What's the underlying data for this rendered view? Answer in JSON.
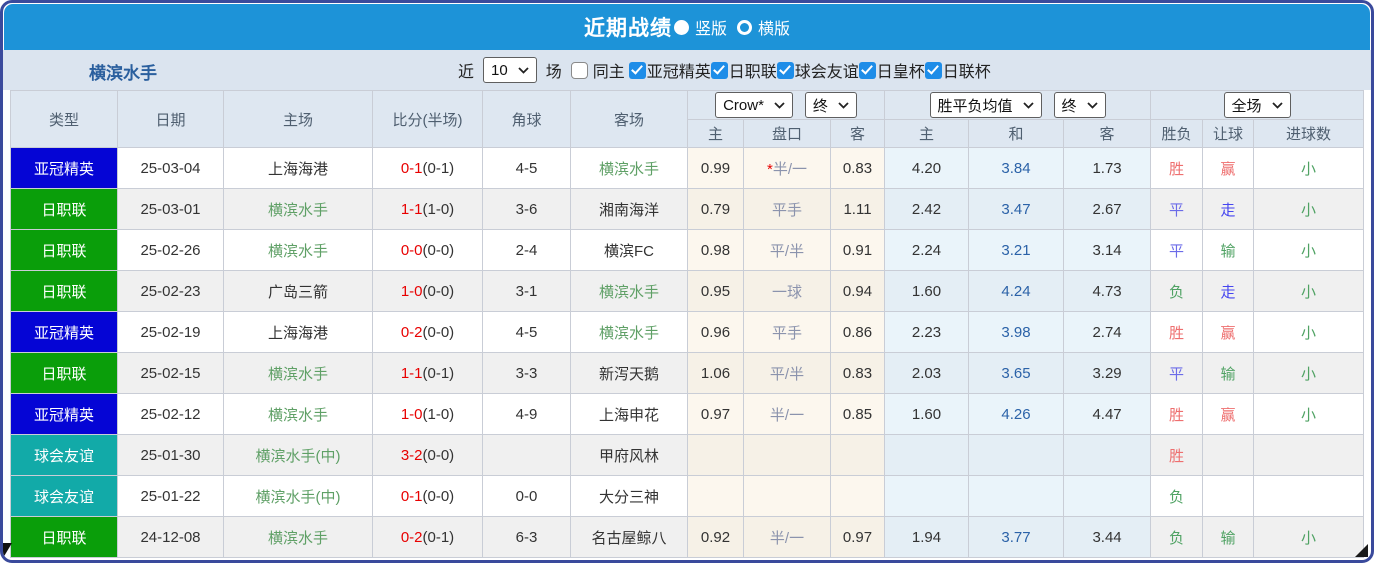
{
  "colors": {
    "topbar": "#1d93d8",
    "frame": "#3a4a9c",
    "filter_bg": "#dbe4ef",
    "header_bg": "#dee7f1",
    "header_text": "#4f5f70",
    "row_alt": "#f0f0f0",
    "odds_left_bg": "#fcf7ee",
    "odds_right_bg": "#eaf4fa",
    "cell_border": "#c9cdd6",
    "team_blue": "#2a5f9e",
    "team_green": "#5fa066",
    "score_red": "#e80000",
    "handicap_slate": "#8b93ad",
    "avg_blue": "#2b62a8",
    "checkbox_blue": "#1e8de8",
    "type_blue": "#0505d5",
    "type_green": "#0a9e0a",
    "type_teal": "#12aaa8",
    "red": "#ee6f6f",
    "blue": "#6b6be8",
    "blue2": "#4646f0",
    "green": "#4fa263",
    "indicator_green": "#0a8a0a"
  },
  "titlebar": {
    "title": "近期战绩",
    "radios": [
      {
        "label": "竖版",
        "selected": false
      },
      {
        "label": "横版",
        "selected": true
      }
    ]
  },
  "filterbar": {
    "team": "横滨水手",
    "near_label": "近",
    "matches_select": "10",
    "games_label": "场",
    "same_home": {
      "label": "同主",
      "checked": false
    },
    "leagues": [
      {
        "label": "亚冠精英",
        "checked": true
      },
      {
        "label": "日职联",
        "checked": true
      },
      {
        "label": "球会友谊",
        "checked": true
      },
      {
        "label": "日皇杯",
        "checked": true
      },
      {
        "label": "日联杯",
        "checked": true
      }
    ]
  },
  "table": {
    "main_headers": [
      "类型",
      "日期",
      "主场",
      "比分(半场)",
      "角球",
      "客场"
    ],
    "selects": {
      "odds_company": "Crow*",
      "odds_time": "终",
      "avg_label": "胜平负均值",
      "avg_time": "终",
      "full_match": "全场"
    },
    "sub_headers": [
      "主",
      "盘口",
      "客",
      "主",
      "和",
      "客",
      "胜负",
      "让球",
      "进球数"
    ],
    "rows": [
      {
        "type": "亚冠精英",
        "type_color": "blue",
        "date": "25-03-04",
        "home": "上海海港",
        "home_green": false,
        "score": "0-1",
        "half": "(0-1)",
        "corner": "4-5",
        "away": "横滨水手",
        "away_green": true,
        "crow_home": "0.99",
        "handicap": "半/一",
        "handicap_star": true,
        "crow_away": "0.83",
        "avg_win": "4.20",
        "avg_draw": "3.84",
        "avg_lose": "1.73",
        "result": "胜",
        "result_color": "red",
        "let_result": "赢",
        "let_color": "red",
        "goals": "小",
        "goals_color": "green"
      },
      {
        "type": "日职联",
        "type_color": "green",
        "date": "25-03-01",
        "home": "横滨水手",
        "home_green": true,
        "score": "1-1",
        "half": "(1-0)",
        "corner": "3-6",
        "away": "湘南海洋",
        "away_green": false,
        "crow_home": "0.79",
        "handicap": "平手",
        "handicap_star": false,
        "crow_away": "1.11",
        "avg_win": "2.42",
        "avg_draw": "3.47",
        "avg_lose": "2.67",
        "result": "平",
        "result_color": "blue",
        "let_result": "走",
        "let_color": "blue2",
        "goals": "小",
        "goals_color": "green"
      },
      {
        "type": "日职联",
        "type_color": "green",
        "date": "25-02-26",
        "home": "横滨水手",
        "home_green": true,
        "score": "0-0",
        "half": "(0-0)",
        "corner": "2-4",
        "away": "横滨FC",
        "away_green": false,
        "crow_home": "0.98",
        "handicap": "平/半",
        "handicap_star": false,
        "crow_away": "0.91",
        "avg_win": "2.24",
        "avg_draw": "3.21",
        "avg_lose": "3.14",
        "result": "平",
        "result_color": "blue",
        "let_result": "输",
        "let_color": "green",
        "goals": "小",
        "goals_color": "green"
      },
      {
        "type": "日职联",
        "type_color": "green",
        "date": "25-02-23",
        "home": "广岛三箭",
        "home_green": false,
        "score": "1-0",
        "half": "(0-0)",
        "corner": "3-1",
        "away": "横滨水手",
        "away_green": true,
        "crow_home": "0.95",
        "handicap": "一球",
        "handicap_star": false,
        "crow_away": "0.94",
        "avg_win": "1.60",
        "avg_draw": "4.24",
        "avg_lose": "4.73",
        "result": "负",
        "result_color": "green",
        "let_result": "走",
        "let_color": "blue2",
        "goals": "小",
        "goals_color": "green"
      },
      {
        "type": "亚冠精英",
        "type_color": "blue",
        "date": "25-02-19",
        "home": "上海海港",
        "home_green": false,
        "score": "0-2",
        "half": "(0-0)",
        "corner": "4-5",
        "away": "横滨水手",
        "away_green": true,
        "crow_home": "0.96",
        "handicap": "平手",
        "handicap_star": false,
        "crow_away": "0.86",
        "avg_win": "2.23",
        "avg_draw": "3.98",
        "avg_lose": "2.74",
        "result": "胜",
        "result_color": "red",
        "let_result": "赢",
        "let_color": "red",
        "goals": "小",
        "goals_color": "green"
      },
      {
        "type": "日职联",
        "type_color": "green",
        "date": "25-02-15",
        "home": "横滨水手",
        "home_green": true,
        "score": "1-1",
        "half": "(0-1)",
        "corner": "3-3",
        "away": "新泻天鹅",
        "away_green": false,
        "crow_home": "1.06",
        "handicap": "平/半",
        "handicap_star": false,
        "crow_away": "0.83",
        "avg_win": "2.03",
        "avg_draw": "3.65",
        "avg_lose": "3.29",
        "result": "平",
        "result_color": "blue",
        "let_result": "输",
        "let_color": "green",
        "goals": "小",
        "goals_color": "green"
      },
      {
        "type": "亚冠精英",
        "type_color": "blue",
        "date": "25-02-12",
        "home": "横滨水手",
        "home_green": true,
        "score": "1-0",
        "half": "(1-0)",
        "corner": "4-9",
        "away": "上海申花",
        "away_green": false,
        "crow_home": "0.97",
        "handicap": "半/一",
        "handicap_star": false,
        "crow_away": "0.85",
        "avg_win": "1.60",
        "avg_draw": "4.26",
        "avg_lose": "4.47",
        "result": "胜",
        "result_color": "red",
        "let_result": "赢",
        "let_color": "red",
        "goals": "小",
        "goals_color": "green"
      },
      {
        "type": "球会友谊",
        "type_color": "teal",
        "date": "25-01-30",
        "home": "横滨水手(中)",
        "home_green": true,
        "score": "3-2",
        "half": "(0-0)",
        "corner": "",
        "away": "甲府风林",
        "away_green": false,
        "crow_home": "",
        "handicap": "",
        "handicap_star": false,
        "crow_away": "",
        "avg_win": "",
        "avg_draw": "",
        "avg_lose": "",
        "result": "胜",
        "result_color": "red",
        "let_result": "",
        "let_color": "",
        "goals": "",
        "goals_color": ""
      },
      {
        "type": "球会友谊",
        "type_color": "teal",
        "date": "25-01-22",
        "home": "横滨水手(中)",
        "home_green": true,
        "score": "0-1",
        "half": "(0-0)",
        "corner": "0-0",
        "away": "大分三神",
        "away_green": false,
        "crow_home": "",
        "handicap": "",
        "handicap_star": false,
        "crow_away": "",
        "avg_win": "",
        "avg_draw": "",
        "avg_lose": "",
        "result": "负",
        "result_color": "green",
        "let_result": "",
        "let_color": "",
        "goals": "",
        "goals_color": ""
      },
      {
        "type": "日职联",
        "type_color": "green",
        "date": "24-12-08",
        "home": "横滨水手",
        "home_green": true,
        "score": "0-2",
        "half": "(0-1)",
        "corner": "6-3",
        "away": "名古屋鲸八",
        "away_green": false,
        "crow_home": "0.92",
        "handicap": "半/一",
        "handicap_star": false,
        "crow_away": "0.97",
        "avg_win": "1.94",
        "avg_draw": "3.77",
        "avg_lose": "3.44",
        "result": "负",
        "result_color": "green",
        "let_result": "输",
        "let_color": "green",
        "goals": "小",
        "goals_color": "green"
      }
    ]
  }
}
